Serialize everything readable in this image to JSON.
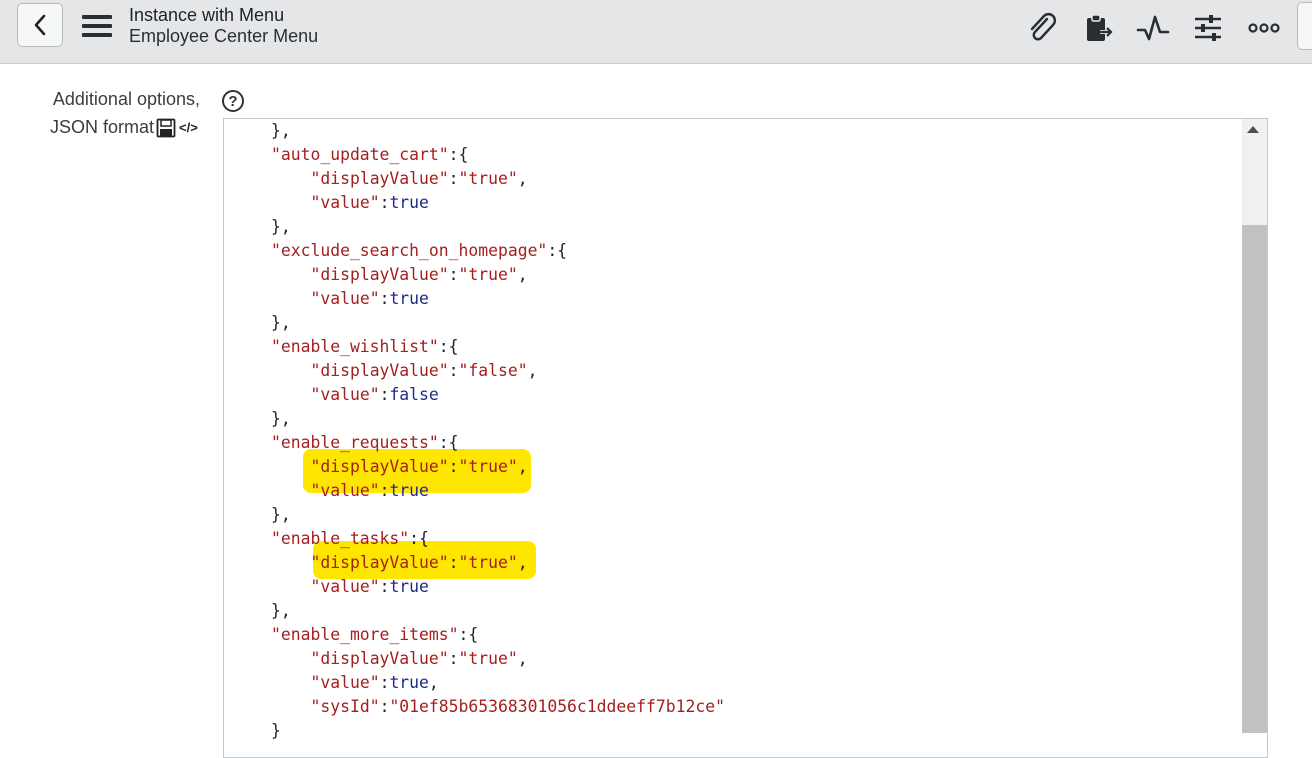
{
  "header": {
    "title": "Instance with Menu",
    "subtitle": "Employee Center Menu",
    "back_icon": "chevron-left-icon",
    "menu_icon": "hamburger-icon",
    "tools": [
      "paperclip-icon",
      "clipboard-export-icon",
      "activity-icon",
      "sliders-icon",
      "more-icon"
    ]
  },
  "field": {
    "label_line1": "Additional options,",
    "label_line2": "JSON format",
    "code_toggle": "</>",
    "help": "?"
  },
  "highlight_color": "#ffe600",
  "code_lines": [
    [
      [
        "p",
        "},"
      ]
    ],
    [
      [
        "k",
        "\"auto_update_cart\""
      ],
      [
        "p",
        ":{"
      ]
    ],
    [
      [
        "p",
        "    "
      ],
      [
        "k",
        "\"displayValue\""
      ],
      [
        "p",
        ":"
      ],
      [
        "s",
        "\"true\""
      ],
      [
        "p",
        ","
      ]
    ],
    [
      [
        "p",
        "    "
      ],
      [
        "k",
        "\"value\""
      ],
      [
        "p",
        ":"
      ],
      [
        "b",
        "true"
      ]
    ],
    [
      [
        "p",
        "},"
      ]
    ],
    [
      [
        "k",
        "\"exclude_search_on_homepage\""
      ],
      [
        "p",
        ":{"
      ]
    ],
    [
      [
        "p",
        "    "
      ],
      [
        "k",
        "\"displayValue\""
      ],
      [
        "p",
        ":"
      ],
      [
        "s",
        "\"true\""
      ],
      [
        "p",
        ","
      ]
    ],
    [
      [
        "p",
        "    "
      ],
      [
        "k",
        "\"value\""
      ],
      [
        "p",
        ":"
      ],
      [
        "b",
        "true"
      ]
    ],
    [
      [
        "p",
        "},"
      ]
    ],
    [
      [
        "k",
        "\"enable_wishlist\""
      ],
      [
        "p",
        ":{"
      ]
    ],
    [
      [
        "p",
        "    "
      ],
      [
        "k",
        "\"displayValue\""
      ],
      [
        "p",
        ":"
      ],
      [
        "s",
        "\"false\""
      ],
      [
        "p",
        ","
      ]
    ],
    [
      [
        "p",
        "    "
      ],
      [
        "k",
        "\"value\""
      ],
      [
        "p",
        ":"
      ],
      [
        "b",
        "false"
      ]
    ],
    [
      [
        "p",
        "},"
      ]
    ],
    [
      [
        "k",
        "\"enable_requests\""
      ],
      [
        "p",
        ":{"
      ]
    ],
    [
      [
        "p",
        "    "
      ],
      [
        "k",
        "\"displayValue\""
      ],
      [
        "p",
        ":"
      ],
      [
        "s",
        "\"true\""
      ],
      [
        "p",
        ","
      ]
    ],
    [
      [
        "p",
        "    "
      ],
      [
        "k",
        "\"value\""
      ],
      [
        "p",
        ":"
      ],
      [
        "b",
        "true"
      ]
    ],
    [
      [
        "p",
        "},"
      ]
    ],
    [
      [
        "k",
        "\"enable_tasks\""
      ],
      [
        "p",
        ":{"
      ]
    ],
    [
      [
        "p",
        "    "
      ],
      [
        "k",
        "\"displayValue\""
      ],
      [
        "p",
        ":"
      ],
      [
        "s",
        "\"true\""
      ],
      [
        "p",
        ","
      ]
    ],
    [
      [
        "p",
        "    "
      ],
      [
        "k",
        "\"value\""
      ],
      [
        "p",
        ":"
      ],
      [
        "b",
        "true"
      ]
    ],
    [
      [
        "p",
        "},"
      ]
    ],
    [
      [
        "k",
        "\"enable_more_items\""
      ],
      [
        "p",
        ":{"
      ]
    ],
    [
      [
        "p",
        "    "
      ],
      [
        "k",
        "\"displayValue\""
      ],
      [
        "p",
        ":"
      ],
      [
        "s",
        "\"true\""
      ],
      [
        "p",
        ","
      ]
    ],
    [
      [
        "p",
        "    "
      ],
      [
        "k",
        "\"value\""
      ],
      [
        "p",
        ":"
      ],
      [
        "b",
        "true"
      ],
      [
        "p",
        ","
      ]
    ],
    [
      [
        "p",
        "    "
      ],
      [
        "k",
        "\"sysId\""
      ],
      [
        "p",
        ":"
      ],
      [
        "s",
        "\"01ef85b65368301056c1ddeeff7b12ce\""
      ]
    ],
    [
      [
        "p",
        "}"
      ]
    ]
  ]
}
